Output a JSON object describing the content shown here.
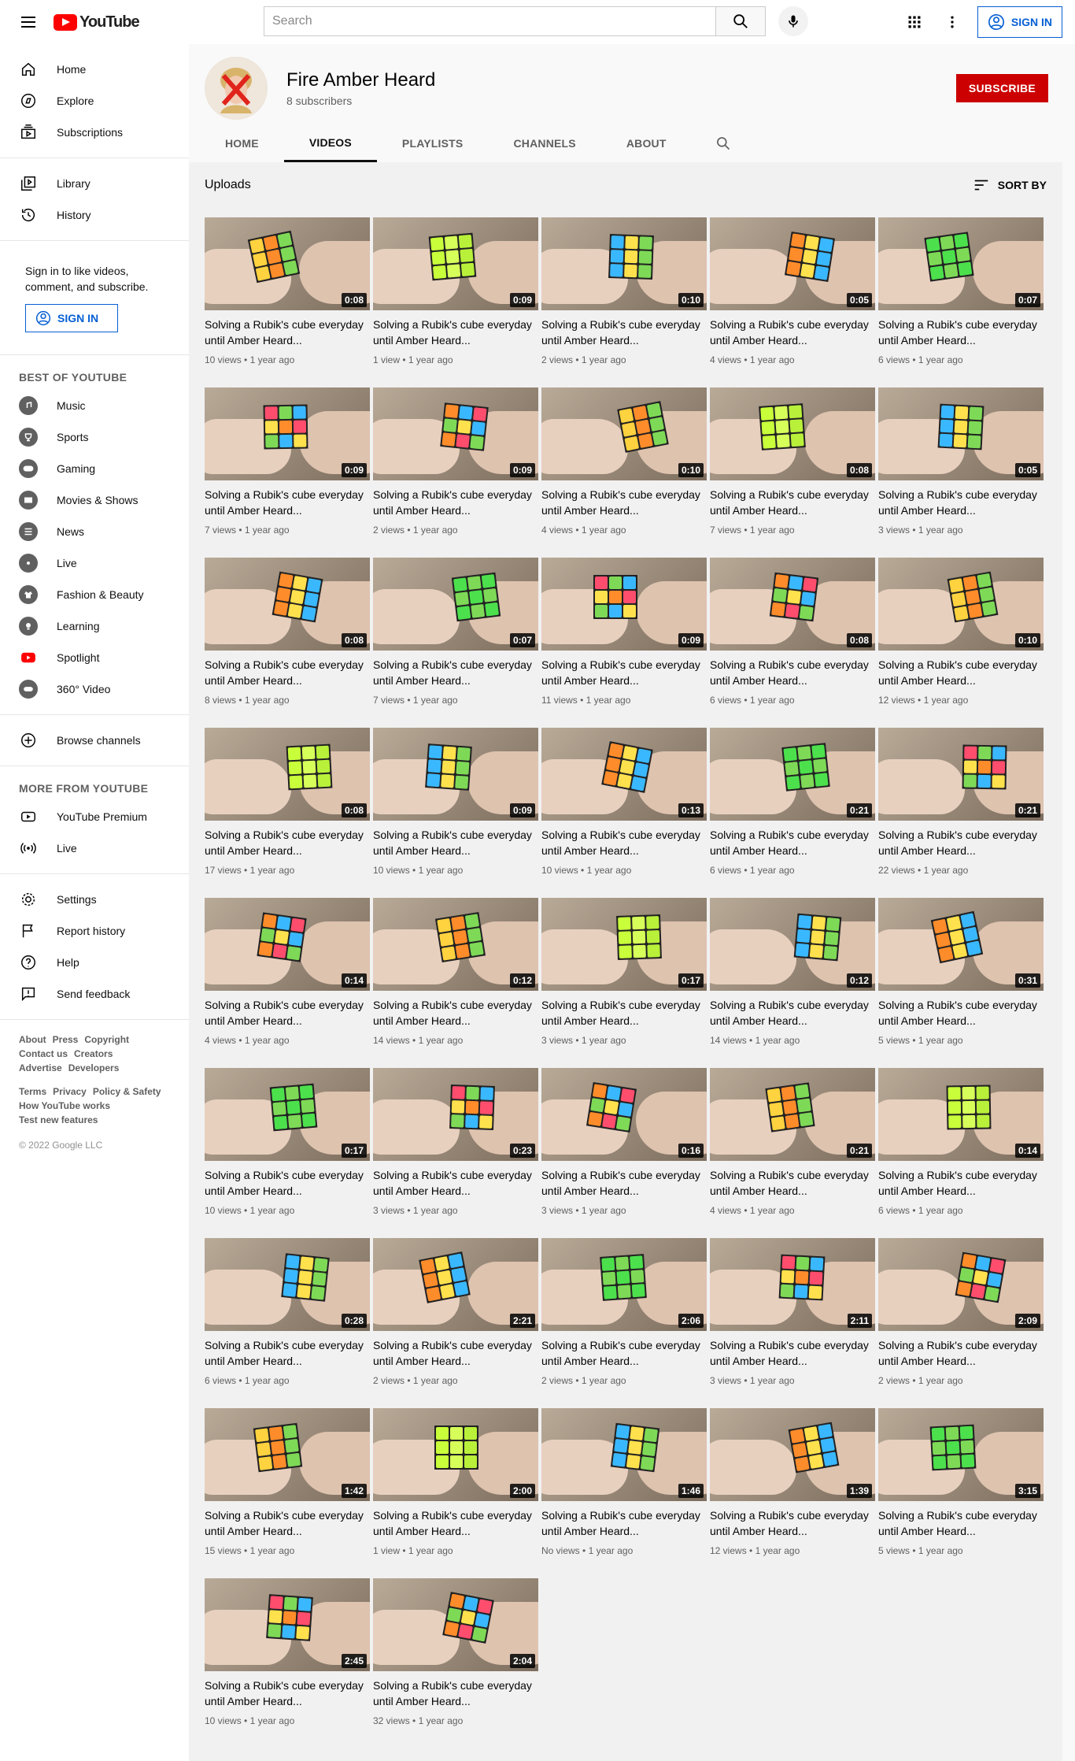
{
  "header": {
    "logo_text": "YouTube",
    "search_placeholder": "Search",
    "sign_in": "SIGN IN",
    "icons": [
      "menu-icon",
      "search-icon",
      "mic-icon",
      "apps-icon",
      "more-vert-icon",
      "account-icon"
    ]
  },
  "sidebar": {
    "main": [
      {
        "label": "Home",
        "icon": "home-icon"
      },
      {
        "label": "Explore",
        "icon": "explore-icon"
      },
      {
        "label": "Subscriptions",
        "icon": "subscriptions-icon"
      }
    ],
    "library": [
      {
        "label": "Library",
        "icon": "library-icon"
      },
      {
        "label": "History",
        "icon": "history-icon"
      }
    ],
    "signin_prompt": "Sign in to like videos, comment, and subscribe.",
    "signin_button": "SIGN IN",
    "best_heading": "BEST OF YOUTUBE",
    "best": [
      {
        "label": "Music",
        "icon": "music-icon"
      },
      {
        "label": "Sports",
        "icon": "sports-icon"
      },
      {
        "label": "Gaming",
        "icon": "gaming-icon"
      },
      {
        "label": "Movies & Shows",
        "icon": "movies-icon"
      },
      {
        "label": "News",
        "icon": "news-icon"
      },
      {
        "label": "Live",
        "icon": "live-icon"
      },
      {
        "label": "Fashion & Beauty",
        "icon": "fashion-icon"
      },
      {
        "label": "Learning",
        "icon": "learning-icon"
      },
      {
        "label": "Spotlight",
        "icon": "spotlight-icon"
      },
      {
        "label": "360° Video",
        "icon": "360-icon"
      }
    ],
    "browse": "Browse channels",
    "more_heading": "MORE FROM YOUTUBE",
    "more": [
      {
        "label": "YouTube Premium",
        "icon": "premium-icon"
      },
      {
        "label": "Live",
        "icon": "live-broadcast-icon"
      }
    ],
    "settings": [
      {
        "label": "Settings",
        "icon": "settings-icon"
      },
      {
        "label": "Report history",
        "icon": "flag-icon"
      },
      {
        "label": "Help",
        "icon": "help-icon"
      },
      {
        "label": "Send feedback",
        "icon": "feedback-icon"
      }
    ],
    "footer_row1": [
      "About",
      "Press",
      "Copyright"
    ],
    "footer_row2": [
      "Contact us",
      "Creators"
    ],
    "footer_row3": [
      "Advertise",
      "Developers"
    ],
    "footer_row4": [
      "Terms",
      "Privacy",
      "Policy & Safety"
    ],
    "footer_row5": [
      "How YouTube works"
    ],
    "footer_row6": [
      "Test new features"
    ],
    "copyright": "© 2022 Google LLC"
  },
  "channel": {
    "name": "Fire Amber Heard",
    "subscribers": "8 subscribers",
    "subscribe": "SUBSCRIBE",
    "tabs": [
      "HOME",
      "VIDEOS",
      "PLAYLISTS",
      "CHANNELS",
      "ABOUT"
    ],
    "active_tab": "VIDEOS"
  },
  "content": {
    "heading": "Uploads",
    "sort_by": "SORT BY",
    "video_title": "Solving a Rubik's cube everyday until Amber Heard...",
    "videos": [
      {
        "duration": "0:08",
        "views": "10 views",
        "age": "1 year ago"
      },
      {
        "duration": "0:09",
        "views": "1 view",
        "age": "1 year ago"
      },
      {
        "duration": "0:10",
        "views": "2 views",
        "age": "1 year ago"
      },
      {
        "duration": "0:05",
        "views": "4 views",
        "age": "1 year ago"
      },
      {
        "duration": "0:07",
        "views": "6 views",
        "age": "1 year ago"
      },
      {
        "duration": "0:09",
        "views": "7 views",
        "age": "1 year ago"
      },
      {
        "duration": "0:09",
        "views": "2 views",
        "age": "1 year ago"
      },
      {
        "duration": "0:10",
        "views": "4 views",
        "age": "1 year ago"
      },
      {
        "duration": "0:08",
        "views": "7 views",
        "age": "1 year ago"
      },
      {
        "duration": "0:05",
        "views": "3 views",
        "age": "1 year ago"
      },
      {
        "duration": "0:08",
        "views": "8 views",
        "age": "1 year ago"
      },
      {
        "duration": "0:07",
        "views": "7 views",
        "age": "1 year ago"
      },
      {
        "duration": "0:09",
        "views": "11 views",
        "age": "1 year ago"
      },
      {
        "duration": "0:08",
        "views": "6 views",
        "age": "1 year ago"
      },
      {
        "duration": "0:10",
        "views": "12 views",
        "age": "1 year ago"
      },
      {
        "duration": "0:08",
        "views": "17 views",
        "age": "1 year ago"
      },
      {
        "duration": "0:09",
        "views": "10 views",
        "age": "1 year ago"
      },
      {
        "duration": "0:13",
        "views": "10 views",
        "age": "1 year ago"
      },
      {
        "duration": "0:21",
        "views": "6 views",
        "age": "1 year ago"
      },
      {
        "duration": "0:21",
        "views": "22 views",
        "age": "1 year ago"
      },
      {
        "duration": "0:14",
        "views": "4 views",
        "age": "1 year ago"
      },
      {
        "duration": "0:12",
        "views": "14 views",
        "age": "1 year ago"
      },
      {
        "duration": "0:17",
        "views": "3 views",
        "age": "1 year ago"
      },
      {
        "duration": "0:12",
        "views": "14 views",
        "age": "1 year ago"
      },
      {
        "duration": "0:31",
        "views": "5 views",
        "age": "1 year ago"
      },
      {
        "duration": "0:17",
        "views": "10 views",
        "age": "1 year ago"
      },
      {
        "duration": "0:23",
        "views": "3 views",
        "age": "1 year ago"
      },
      {
        "duration": "0:16",
        "views": "3 views",
        "age": "1 year ago"
      },
      {
        "duration": "0:21",
        "views": "4 views",
        "age": "1 year ago"
      },
      {
        "duration": "0:14",
        "views": "6 views",
        "age": "1 year ago"
      },
      {
        "duration": "0:28",
        "views": "6 views",
        "age": "1 year ago"
      },
      {
        "duration": "2:21",
        "views": "2 views",
        "age": "1 year ago"
      },
      {
        "duration": "2:06",
        "views": "2 views",
        "age": "1 year ago"
      },
      {
        "duration": "2:11",
        "views": "3 views",
        "age": "1 year ago"
      },
      {
        "duration": "2:09",
        "views": "2 views",
        "age": "1 year ago"
      },
      {
        "duration": "1:42",
        "views": "15 views",
        "age": "1 year ago"
      },
      {
        "duration": "2:00",
        "views": "1 view",
        "age": "1 year ago"
      },
      {
        "duration": "1:46",
        "views": "No views",
        "age": "1 year ago"
      },
      {
        "duration": "1:39",
        "views": "12 views",
        "age": "1 year ago"
      },
      {
        "duration": "3:15",
        "views": "5 views",
        "age": "1 year ago"
      },
      {
        "duration": "2:45",
        "views": "10 views",
        "age": "1 year ago"
      },
      {
        "duration": "2:04",
        "views": "32 views",
        "age": "1 year ago"
      }
    ]
  },
  "colors": {
    "accent_blue": "#065fd4",
    "subscribe_red": "#cc0000",
    "logo_red": "#ff0000"
  }
}
